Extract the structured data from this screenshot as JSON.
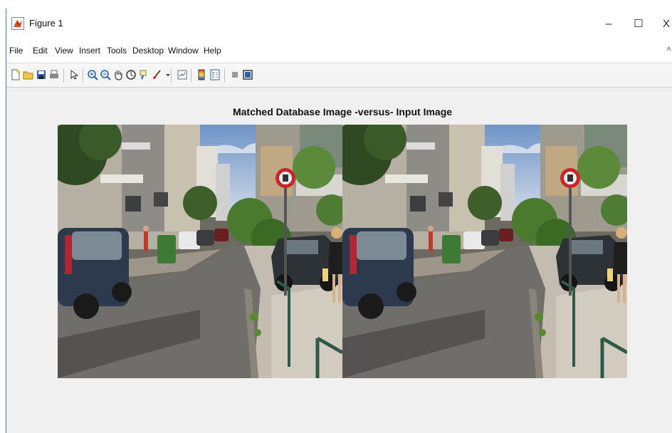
{
  "window": {
    "title": "Figure 1",
    "controls": {
      "minimize": "–",
      "maximize": "☐",
      "close": "X"
    }
  },
  "menu": {
    "items": [
      "File",
      "Edit",
      "View",
      "Insert",
      "Tools",
      "Desktop",
      "Window",
      "Help"
    ],
    "overflow": "˄"
  },
  "toolbar": {
    "buttons": [
      "new-figure-icon",
      "open-file-icon",
      "save-icon",
      "print-icon",
      "select-pointer-icon",
      "zoom-in-icon",
      "zoom-out-icon",
      "pan-hand-icon",
      "rotate-3d-icon",
      "data-cursor-icon",
      "brush-icon",
      "link-plot-icon",
      "colorbar-icon",
      "legend-icon",
      "hide-plot-tools-icon",
      "show-plot-tools-icon"
    ]
  },
  "figure": {
    "title": "Matched Database Image -versus- Input Image",
    "images": [
      "matched-database-image",
      "input-image"
    ]
  },
  "colors": {
    "accent": "#3c7fb1",
    "sign_red": "#c8262a",
    "bin_green": "#3e7a36",
    "sky": "#9fb7d6"
  }
}
